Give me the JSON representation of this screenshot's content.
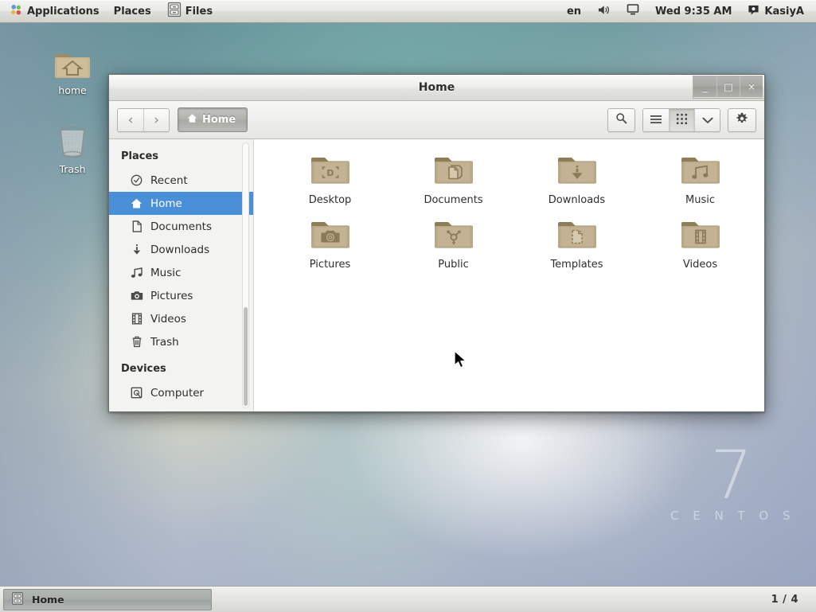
{
  "top_panel": {
    "applications_label": "Applications",
    "places_label": "Places",
    "active_app_label": "Files",
    "keyboard_layout": "en",
    "volume_icon": "volume-icon",
    "display_icon": "display-icon",
    "clock": "Wed  9:35 AM",
    "user_name": "KasiyA"
  },
  "desktop": {
    "icons": [
      {
        "name": "home",
        "label": "home",
        "icon": "home-folder-icon"
      },
      {
        "name": "trash",
        "label": "Trash",
        "icon": "trash-icon"
      }
    ],
    "watermark": {
      "version": "7",
      "word": "C E N T O S"
    }
  },
  "window": {
    "title": "Home",
    "controls": {
      "minimize": "_",
      "maximize": "□",
      "close": "×"
    },
    "toolbar": {
      "back_label": "‹",
      "forward_label": "›",
      "path_button_label": "Home",
      "search_label": "search-icon",
      "list_view_label": "list-view-icon",
      "grid_view_label": "grid-view-icon",
      "view_dropdown_label": "chevron-down-icon",
      "settings_label": "gear-icon",
      "active_view": "grid"
    }
  },
  "sidebar": {
    "sections": [
      {
        "heading": "Places",
        "items": [
          {
            "label": "Recent",
            "icon": "clock-icon",
            "selected": false
          },
          {
            "label": "Home",
            "icon": "home-icon",
            "selected": true
          },
          {
            "label": "Documents",
            "icon": "document-icon",
            "selected": false
          },
          {
            "label": "Downloads",
            "icon": "download-icon",
            "selected": false
          },
          {
            "label": "Music",
            "icon": "music-note-icon",
            "selected": false
          },
          {
            "label": "Pictures",
            "icon": "camera-icon",
            "selected": false
          },
          {
            "label": "Videos",
            "icon": "film-icon",
            "selected": false
          },
          {
            "label": "Trash",
            "icon": "trash-icon",
            "selected": false
          }
        ]
      },
      {
        "heading": "Devices",
        "items": [
          {
            "label": "Computer",
            "icon": "computer-icon",
            "selected": false
          }
        ]
      }
    ]
  },
  "file_view": {
    "view_mode": "grid",
    "items": [
      {
        "label": "Desktop",
        "emblem": "desktop-emblem"
      },
      {
        "label": "Documents",
        "emblem": "documents-emblem"
      },
      {
        "label": "Downloads",
        "emblem": "downloads-emblem"
      },
      {
        "label": "Music",
        "emblem": "music-emblem"
      },
      {
        "label": "Pictures",
        "emblem": "pictures-emblem"
      },
      {
        "label": "Public",
        "emblem": "public-emblem"
      },
      {
        "label": "Templates",
        "emblem": "templates-emblem"
      },
      {
        "label": "Videos",
        "emblem": "videos-emblem"
      }
    ]
  },
  "bottom_panel": {
    "task_label": "Home",
    "task_icon": "files-icon",
    "workspace_indicator": "1 / 4"
  },
  "colors": {
    "selection_blue": "#4a90d9",
    "folder_tan": "#bfae8e",
    "panel_grey": "#e4e4e1"
  }
}
